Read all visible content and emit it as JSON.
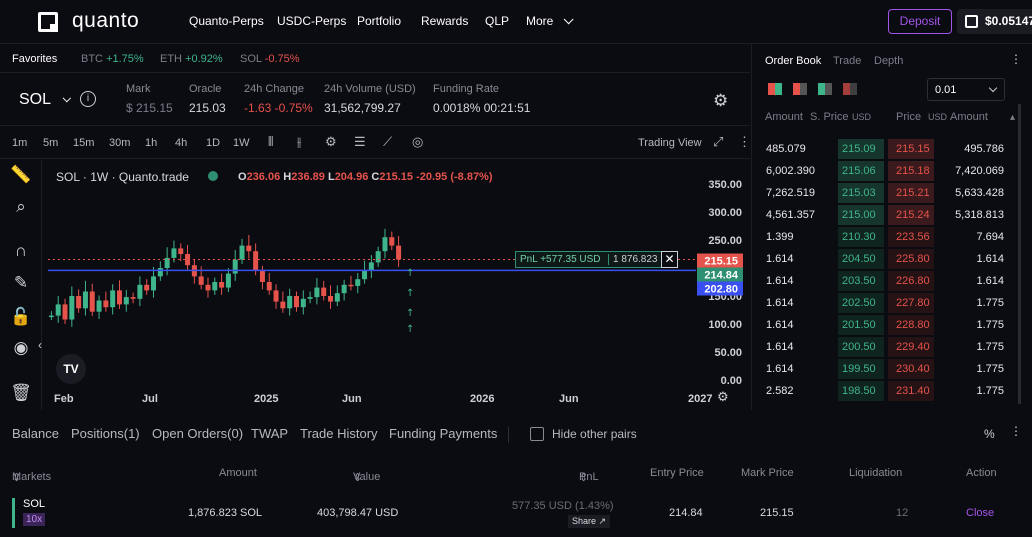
{
  "brand": {
    "name": "quanto"
  },
  "nav": [
    "Quanto-Perps",
    "USDC-Perps",
    "Portfolio",
    "Rewards",
    "QLP",
    "More"
  ],
  "header": {
    "deposit_label": "Deposit",
    "balance": "$0.05147"
  },
  "favorites": {
    "label": "Favorites",
    "items": [
      {
        "sym": "BTC",
        "chg": "+1.75%",
        "dir": "up"
      },
      {
        "sym": "ETH",
        "chg": "+0.92%",
        "dir": "up"
      },
      {
        "sym": "SOL",
        "chg": "-0.75%",
        "dir": "down"
      }
    ]
  },
  "ticker": {
    "symbol": "SOL",
    "mark_label": "Mark",
    "mark": "$ 215.15",
    "oracle_label": "Oracle",
    "oracle": "215.03",
    "chg_label": "24h Change",
    "chg": "-1.63 -0.75%",
    "vol_label": "24h Volume (USD)",
    "vol": "31,562,799.27",
    "fund_label": "Funding Rate",
    "fund": "0.0018%",
    "fund_time": "00:21:51"
  },
  "timeframes": [
    "1m",
    "5m",
    "15m",
    "30m",
    "1h",
    "4h",
    "1D",
    "1W"
  ],
  "active_tf": "1W",
  "trading_view_label": "Trading View",
  "chart_data": {
    "type": "candlestick",
    "legend": {
      "title": "SOL · 1W · Quanto.trade",
      "o_label": "O",
      "o": "236.06",
      "h_label": "H",
      "h": "236.89",
      "l_label": "L",
      "l": "204.96",
      "c_label": "C",
      "c": "215.15",
      "chg": "-20.95 (-8.87%)"
    },
    "y_ticks": [
      "350.00",
      "300.00",
      "250.00",
      "200.00",
      "150.00",
      "100.00",
      "50.00",
      "0.00"
    ],
    "y_range": [
      0,
      350
    ],
    "x_ticks": [
      "Feb",
      "Jul",
      "2025",
      "Jun",
      "2026",
      "Jun",
      "2027"
    ],
    "price_tags": [
      {
        "label": "215.15",
        "color": "#e5534b"
      },
      {
        "label": "214.84",
        "color": "#2f8f72"
      },
      {
        "label": "202.80",
        "color": "#3a4ff0"
      }
    ],
    "pnl_box": {
      "pnl": "PnL +577.35 USD",
      "qty": "1 876.823"
    },
    "candles": [
      115,
      135,
      108,
      150,
      128,
      158,
      122,
      142,
      130,
      160,
      135,
      148,
      145,
      170,
      160,
      185,
      200,
      218,
      235,
      225,
      205,
      185,
      170,
      160,
      175,
      165,
      190,
      215,
      240,
      230,
      195,
      175,
      160,
      140,
      128,
      150,
      130,
      145,
      148,
      165,
      150,
      140,
      155,
      170,
      168,
      180,
      195,
      210,
      230,
      255,
      240,
      215
    ]
  },
  "orderbook": {
    "tabs": [
      "Order Book",
      "Trade",
      "Depth"
    ],
    "tick": "0.01",
    "headers": {
      "amount": "Amount",
      "sprice": "S. Price",
      "usd": "USD",
      "price": "Price",
      "usd2": "USD",
      "amount2": "Amount"
    },
    "rows": [
      [
        "485.079",
        "215.09",
        "215.15",
        "495.786"
      ],
      [
        "6,002.390",
        "215.06",
        "215.18",
        "7,420.069"
      ],
      [
        "7,262.519",
        "215.03",
        "215.21",
        "5,633.428"
      ],
      [
        "4,561.357",
        "215.00",
        "215.24",
        "5,318.813"
      ],
      [
        "1.399",
        "210.30",
        "223.56",
        "7.694"
      ],
      [
        "1.614",
        "204.50",
        "225.80",
        "1.614"
      ],
      [
        "1.614",
        "203.50",
        "226.80",
        "1.614"
      ],
      [
        "1.614",
        "202.50",
        "227.80",
        "1.775"
      ],
      [
        "1.614",
        "201.50",
        "228.80",
        "1.775"
      ],
      [
        "1.614",
        "200.50",
        "229.40",
        "1.775"
      ],
      [
        "1.614",
        "199.50",
        "230.40",
        "1.775"
      ],
      [
        "2.582",
        "198.50",
        "231.40",
        "1.775"
      ]
    ]
  },
  "bottom": {
    "tabs": [
      "Balance",
      "Positions(1)",
      "Open Orders(0)",
      "TWAP",
      "Trade History",
      "Funding Payments"
    ],
    "hide_label": "Hide other pairs",
    "pct": "%",
    "headers": [
      "Markets",
      "Amount",
      "Value",
      "PnL",
      "Entry Price",
      "Mark Price",
      "Liquidation",
      "Action"
    ],
    "position": {
      "market": "SOL",
      "lev": "10x",
      "amount": "1,876.823 SOL",
      "value": "403,798.47 USD",
      "pnl": "577.35 USD",
      "pnl_pct": "(1.43%)",
      "share": "Share",
      "entry": "214.84",
      "mark": "215.15",
      "liq": "12",
      "action": "Close"
    }
  }
}
